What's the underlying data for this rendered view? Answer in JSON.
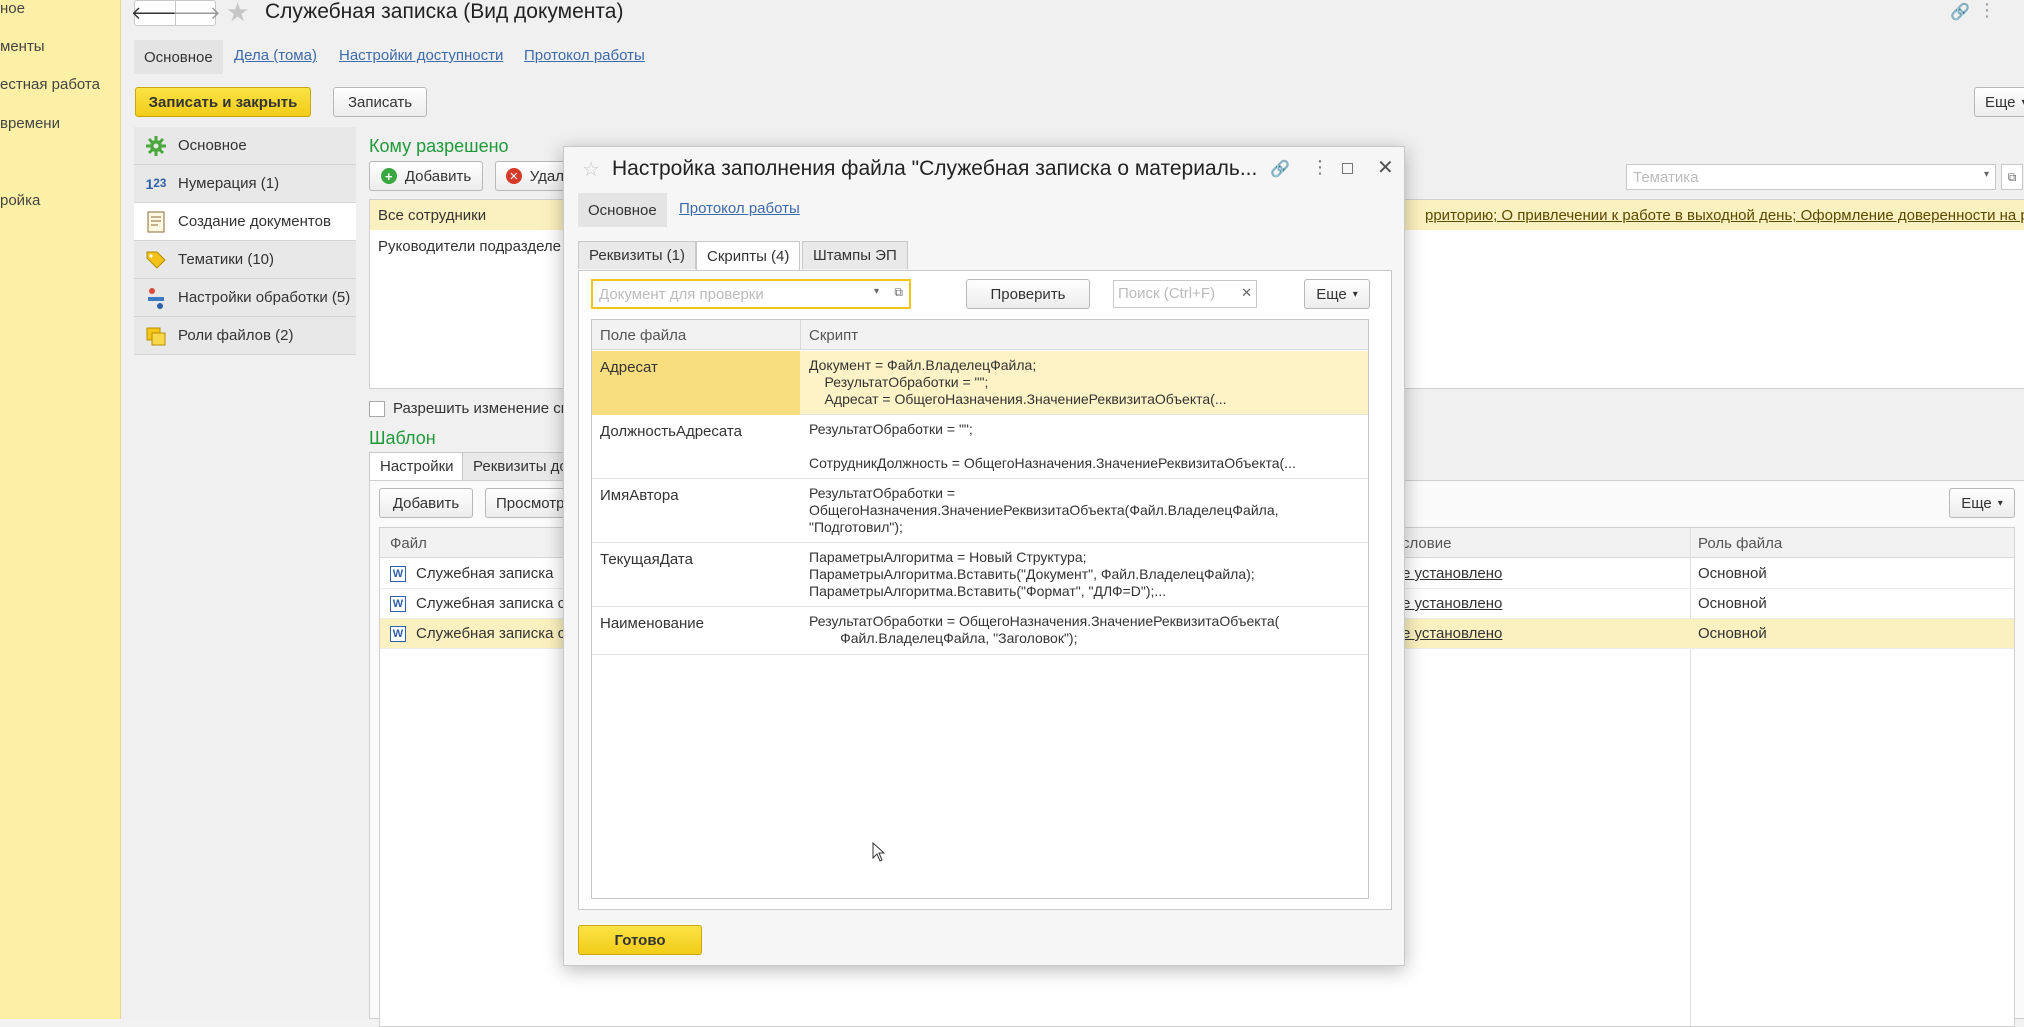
{
  "sidebar": {
    "items": [
      "ное",
      "менты",
      "естная работа",
      "времени",
      "ройка"
    ]
  },
  "header": {
    "title": "Служебная записка (Вид документа)",
    "tabs": [
      "Основное",
      "Дела (тома)",
      "Настройки доступности",
      "Протокол работы"
    ]
  },
  "toolbar": {
    "save_close": "Записать и закрыть",
    "save": "Записать",
    "more": "Еще"
  },
  "left_nav": {
    "items": [
      "Основное",
      "Нумерация (1)",
      "Создание документов",
      "Тематики (10)",
      "Настройки обработки (5)",
      "Роли файлов (2)"
    ]
  },
  "allowed": {
    "title": "Кому разрешено",
    "add": "Добавить",
    "delete": "Удал",
    "rows": [
      "Все сотрудники",
      "Руководители подразделе"
    ],
    "right_text": "рриторию; О привлечении к работе в выходной день; Оформление доверенности на р...",
    "topic_placeholder": "Тематика",
    "allow_change": "Разрешить изменение сп"
  },
  "template": {
    "title": "Шаблон",
    "tabs": [
      "Настройки",
      "Реквизиты до"
    ],
    "add": "Добавить",
    "view": "Просмотр",
    "more": "Еще",
    "col_file": "Файл",
    "col_condition": "словие",
    "col_role": "Роль файла",
    "rows": [
      {
        "file": "Служебная записка",
        "cond": "е установлено",
        "role": "Основной"
      },
      {
        "file": "Служебная записка с",
        "cond": "е установлено",
        "role": "Основной"
      },
      {
        "file": "Служебная записка с",
        "cond": "е установлено",
        "role": "Основной"
      }
    ]
  },
  "dialog": {
    "title": "Настройка заполнения файла \"Служебная записка о материаль...",
    "tabs": [
      "Основное",
      "Протокол работы"
    ],
    "subtabs": [
      "Реквизиты (1)",
      "Скрипты (4)",
      "Штампы ЭП"
    ],
    "doc_placeholder": "Документ для проверки",
    "check": "Проверить",
    "search_placeholder": "Поиск (Ctrl+F)",
    "more": "Еще",
    "col_field": "Поле файла",
    "col_script": "Скрипт",
    "rows": [
      {
        "field": "Адресат",
        "script": "Документ = Файл.ВладелецФайла;\n    РезультатОбработки = \"\";\n    Адресат = ОбщегоНазначения.ЗначениеРеквизитаОбъекта(..."
      },
      {
        "field": "ДолжностьАдресата",
        "script": "РезультатОбработки = \"\";\n\nСотрудникДолжность = ОбщегоНазначения.ЗначениеРеквизитаОбъекта(..."
      },
      {
        "field": "ИмяАвтора",
        "script": "РезультатОбработки =\nОбщегоНазначения.ЗначениеРеквизитаОбъекта(Файл.ВладелецФайла,\n\"Подготовил\");"
      },
      {
        "field": "ТекущаяДата",
        "script": "ПараметрыАлгоритма = Новый Структура;\nПараметрыАлгоритма.Вставить(\"Документ\", Файл.ВладелецФайла);\nПараметрыАлгоритма.Вставить(\"Формат\", \"ДЛФ=D\");..."
      },
      {
        "field": "Наименование",
        "script": "РезультатОбработки = ОбщегоНазначения.ЗначениеРеквизитаОбъекта(\n        Файл.ВладелецФайла, \"Заголовок\");"
      }
    ],
    "done": "Готово"
  },
  "colors": {
    "accent_yellow": "#f5d327",
    "link_blue": "#3d6aa8",
    "section_green": "#1f9a3a",
    "selection": "#fbf0bf"
  }
}
